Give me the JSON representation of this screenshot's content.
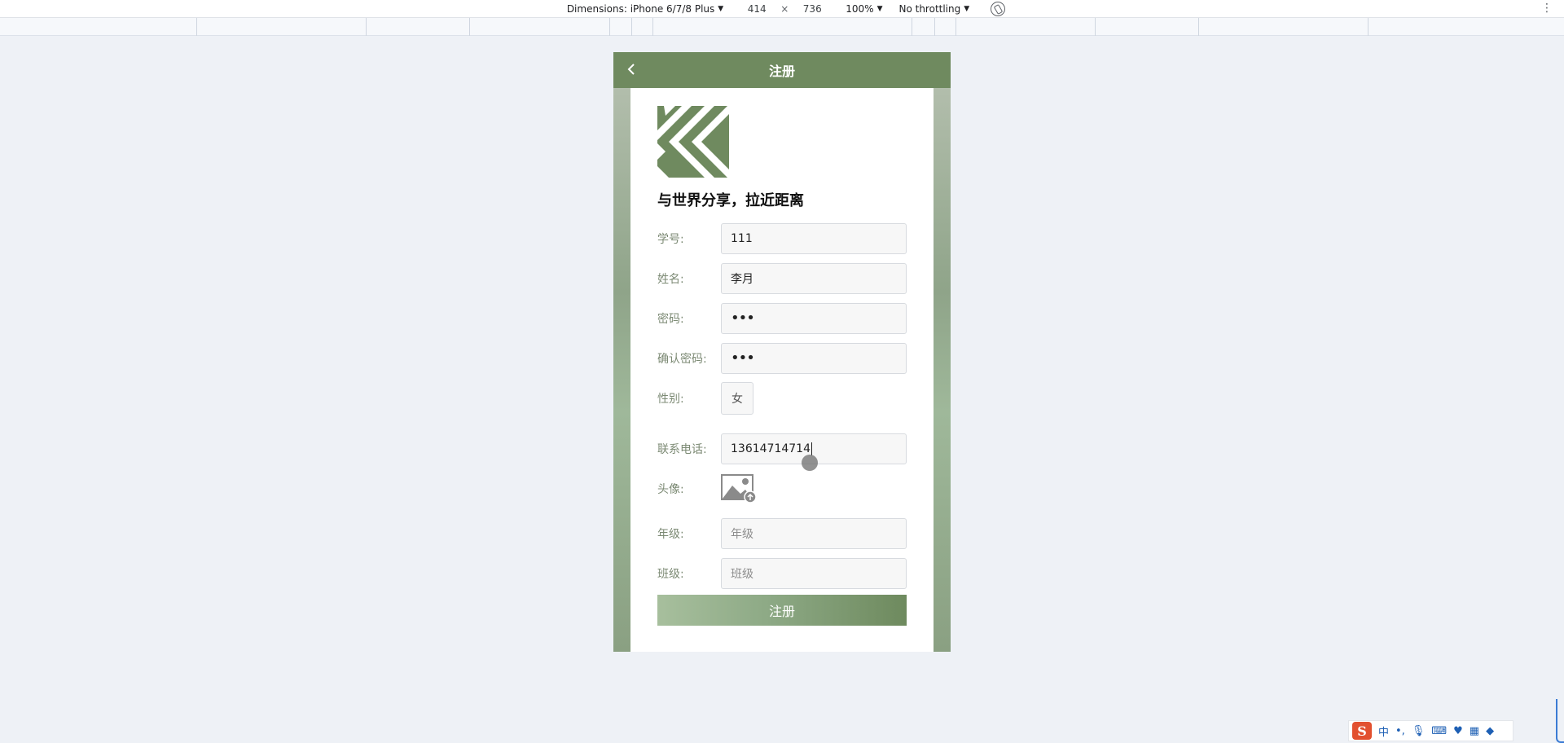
{
  "devtools": {
    "dimensions_label": "Dimensions: iPhone 6/7/8 Plus",
    "width": "414",
    "times": "×",
    "height": "736",
    "zoom": "100%",
    "throttling": "No throttling"
  },
  "nav": {
    "title": "注册"
  },
  "slogan": "与世界分享，拉近距离",
  "form": {
    "student_id": {
      "label": "学号:",
      "value": "111"
    },
    "name": {
      "label": "姓名:",
      "value": "李月"
    },
    "password": {
      "label": "密码:",
      "value": "•••"
    },
    "confirm_password": {
      "label": "确认密码:",
      "value": "•••"
    },
    "gender": {
      "label": "性别:",
      "value": "女"
    },
    "phone": {
      "label": "联系电话:",
      "value": "13614714714"
    },
    "avatar": {
      "label": "头像:"
    },
    "grade": {
      "label": "年级:",
      "placeholder": "年级"
    },
    "class": {
      "label": "班级:",
      "placeholder": "班级"
    },
    "submit_label": "注册"
  },
  "ime": {
    "logo": "S",
    "mode": "中",
    "punct": "•,"
  },
  "colors": {
    "nav_bg": "#6f8a5f",
    "label": "#7c8a74",
    "brand": "#6f8a5f"
  }
}
